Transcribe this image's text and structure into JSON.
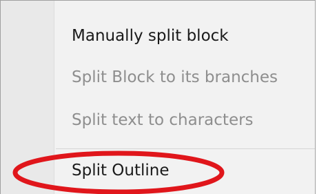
{
  "context_menu": {
    "items": [
      {
        "label": "Manually split block",
        "enabled": true
      },
      {
        "label": "Split Block to its branches",
        "enabled": false
      },
      {
        "label": "Split text to characters",
        "enabled": false
      },
      {
        "label": "Split Outline",
        "enabled": true,
        "highlighted": true
      }
    ]
  },
  "colors": {
    "enabled_text": "#1a1a1a",
    "disabled_text": "#8e8e8e",
    "highlight_ring": "#e0161b",
    "menu_background": "#f2f2f2"
  }
}
